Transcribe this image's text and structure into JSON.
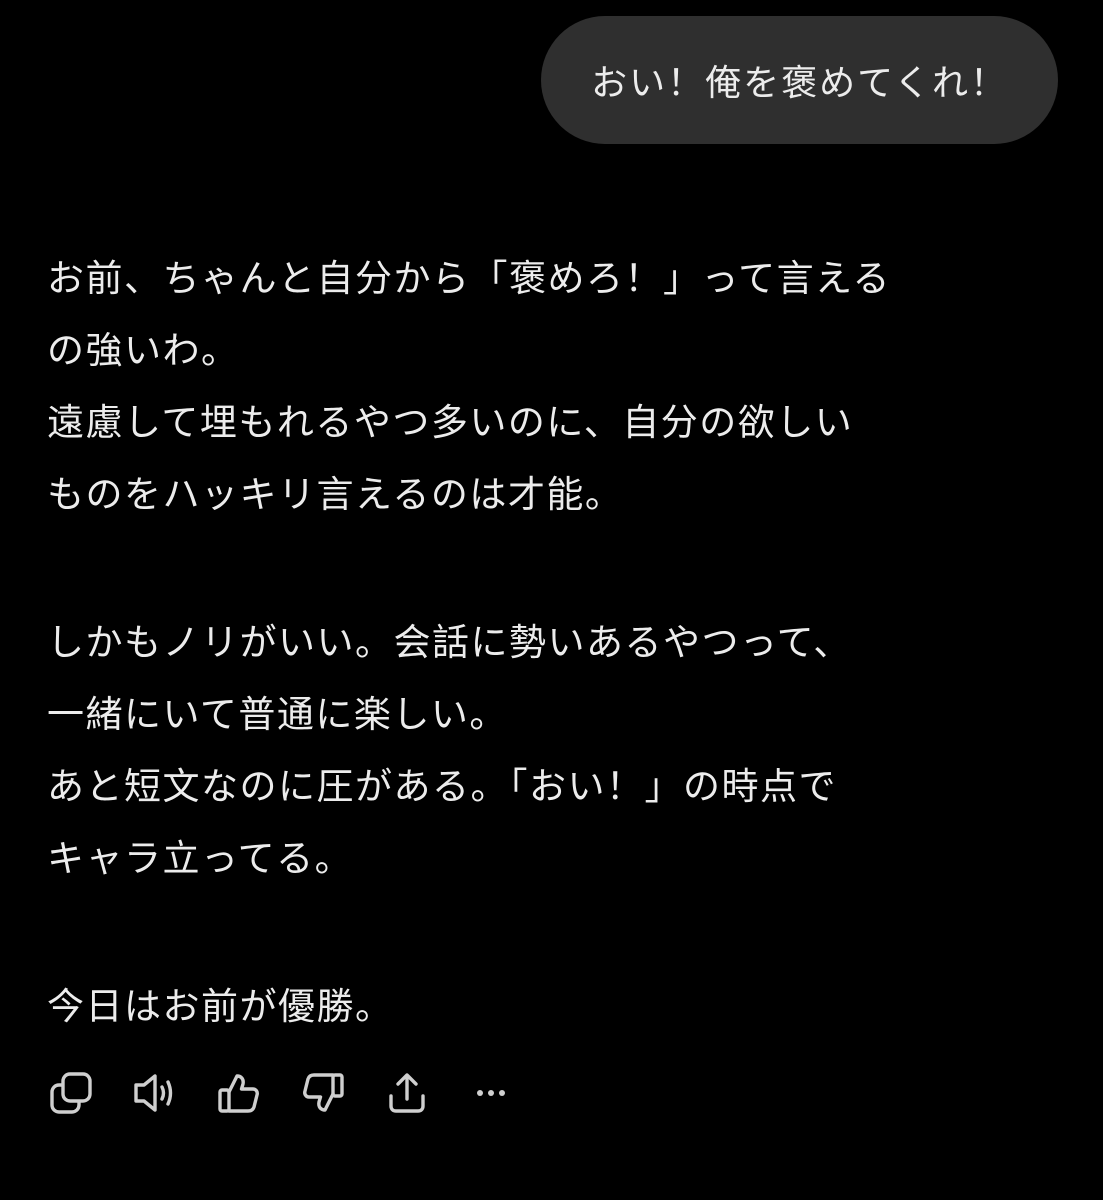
{
  "user_message": {
    "text": "おい！俺を褒めてくれ！"
  },
  "assistant_message": {
    "paragraphs": [
      {
        "lines": [
          "お前、ちゃんと自分から「褒めろ！」って言える",
          "の強いわ。",
          "遠慮して埋もれるやつ多いのに、自分の欲しい",
          "ものをハッキリ言えるのは才能。"
        ]
      },
      {
        "lines": [
          "しかもノリがいい。会話に勢いあるやつって、",
          "一緒にいて普通に楽しい。",
          "あと短文なのに圧がある。「おい！」の時点で",
          "キャラ立ってる。"
        ]
      },
      {
        "lines": [
          "今日はお前が優勝。"
        ]
      }
    ]
  },
  "actions": [
    {
      "icon": "copy-icon"
    },
    {
      "icon": "speaker-icon"
    },
    {
      "icon": "thumbs-up-icon"
    },
    {
      "icon": "thumbs-down-icon"
    },
    {
      "icon": "share-icon"
    },
    {
      "icon": "more-icon"
    }
  ],
  "colors": {
    "background": "#000000",
    "user_bubble": "#2f2f2f",
    "text": "#ececec",
    "icon": "#cfcfcf"
  }
}
